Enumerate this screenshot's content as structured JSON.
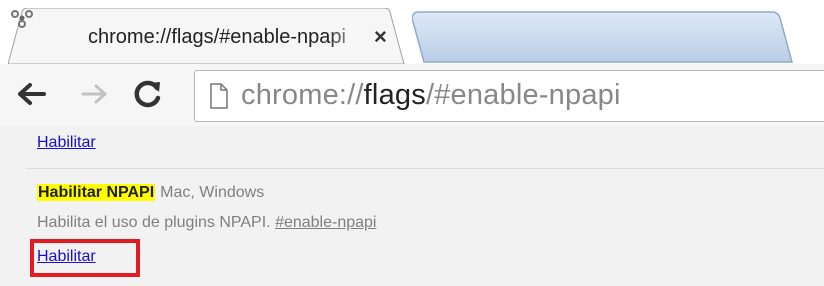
{
  "tab": {
    "title": "chrome://flags/#enable-npapi",
    "close_label": "×"
  },
  "toolbar": {
    "url_scheme": "chrome://",
    "url_host": "flags",
    "url_path": "/#enable-npapi"
  },
  "content": {
    "previous_action": "Habilitar",
    "experiment": {
      "name": "Habilitar NPAPI",
      "platforms": "Mac, Windows",
      "description": "Habilita el uso de plugins NPAPI.",
      "anchor": "#enable-npapi",
      "action": "Habilitar"
    }
  },
  "colors": {
    "link": "#1a0dcd",
    "highlight": "#ffff00",
    "annotation_box": "#e31b23"
  },
  "icons": [
    "biohazard-favicon-icon",
    "close-icon",
    "back-arrow-icon",
    "forward-arrow-icon",
    "reload-icon",
    "page-icon"
  ]
}
